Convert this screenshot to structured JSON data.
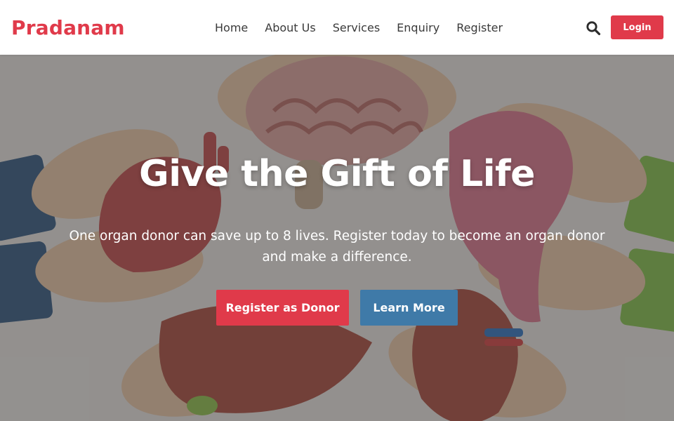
{
  "brand": {
    "name": "Pradanam",
    "color": "#e03a4a"
  },
  "nav": {
    "items": [
      {
        "label": "Home"
      },
      {
        "label": "About Us"
      },
      {
        "label": "Services"
      },
      {
        "label": "Enquiry"
      },
      {
        "label": "Register"
      }
    ]
  },
  "header": {
    "search_icon": "search-icon",
    "login_label": "Login"
  },
  "hero": {
    "title": "Give the Gift of Life",
    "subtitle": "One organ donor can save up to 8 lives. Register today to become an organ donor and make a difference.",
    "primary_button": "Register as Donor",
    "secondary_button": "Learn More",
    "background_icon": "organs-illustration",
    "accent_color": "#e03a4a",
    "secondary_color": "#3f7aa8"
  }
}
